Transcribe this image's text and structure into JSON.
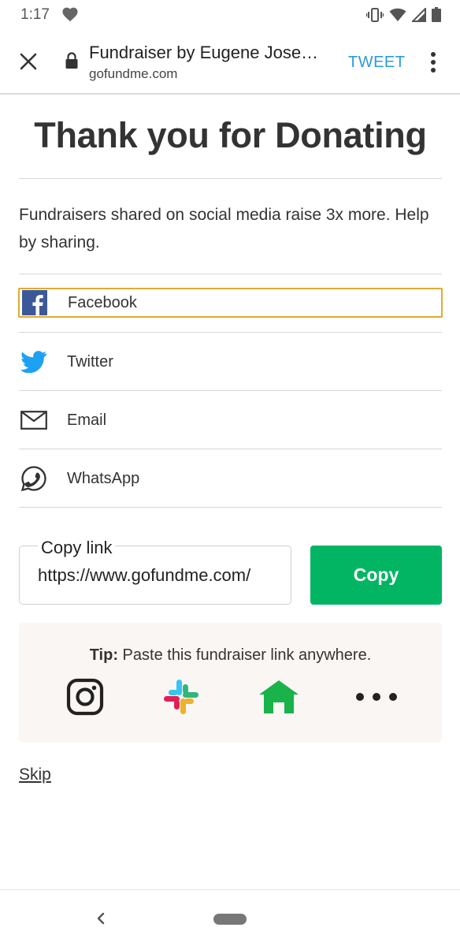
{
  "status_bar": {
    "time": "1:17",
    "icons": [
      "heart-icon",
      "vibrate-icon",
      "wifi-icon",
      "signal-icon",
      "battery-icon"
    ]
  },
  "browser": {
    "title": "Fundraiser by Eugene Jose…",
    "url": "gofundme.com",
    "action_label": "TWEET",
    "action_color": "#2a9bd8"
  },
  "page": {
    "heading": "Thank you for Donating",
    "lead": "Fundraisers shared on social media raise 3x more. Help by sharing.",
    "share_options": [
      {
        "label": "Facebook",
        "icon": "facebook-icon",
        "focused": true
      },
      {
        "label": "Twitter",
        "icon": "twitter-icon"
      },
      {
        "label": "Email",
        "icon": "email-icon"
      },
      {
        "label": "WhatsApp",
        "icon": "whatsapp-icon"
      }
    ],
    "copy_link": {
      "legend": "Copy link",
      "value": "https://www.gofundme.com/",
      "button_label": "Copy",
      "button_color": "#02b563"
    },
    "tip": {
      "prefix": "Tip:",
      "text": " Paste this fundraiser link anywhere.",
      "icons": [
        "instagram-icon",
        "slack-icon",
        "nextdoor-icon",
        "more-icon"
      ]
    },
    "skip_label": "Skip"
  },
  "focus_color": "#e0aa2f"
}
